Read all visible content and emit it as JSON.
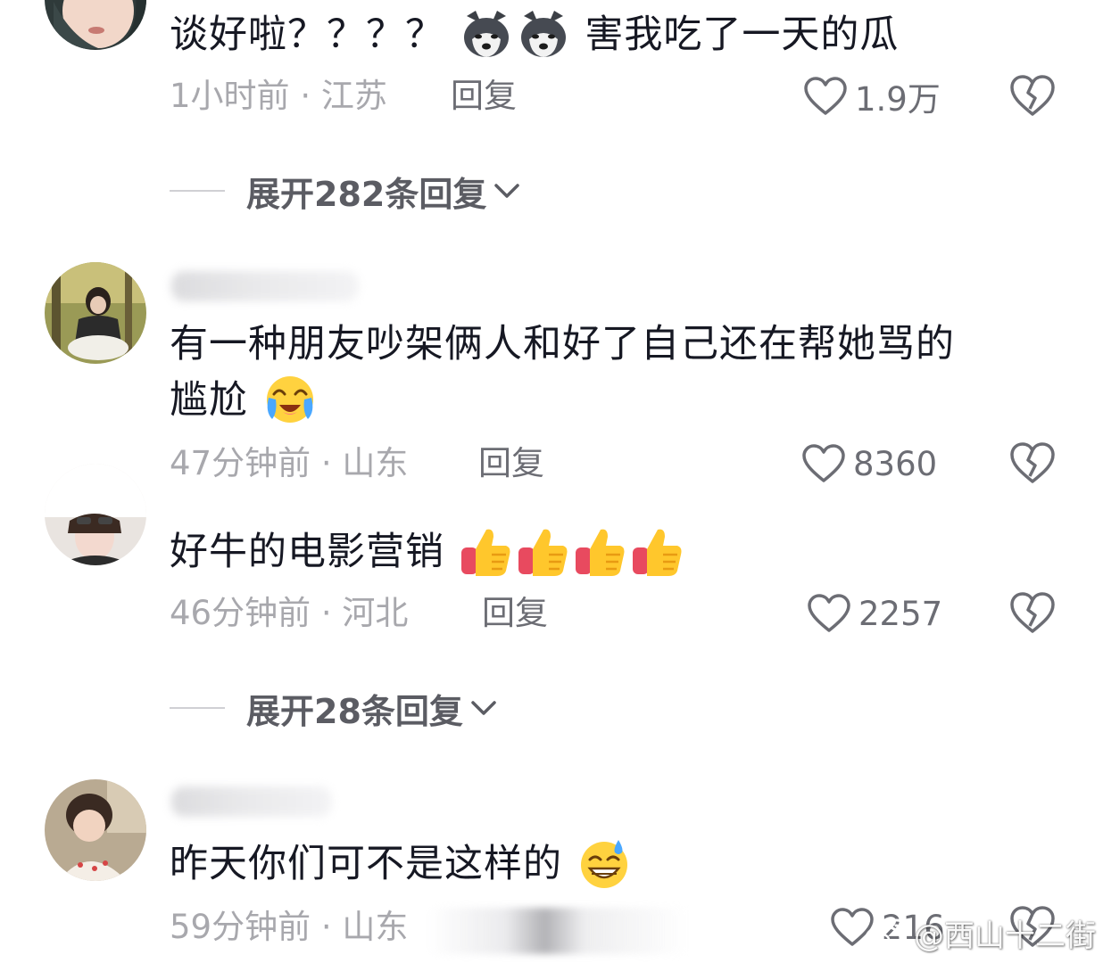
{
  "comments": [
    {
      "text_parts": [
        "谈好啦？？？？",
        "害我吃了一天的瓜"
      ],
      "emojis": [
        "husky-dog-emoji",
        "husky-dog-emoji"
      ],
      "time": "1小时前",
      "separator": "·",
      "location": "江苏",
      "reply_label": "回复",
      "likes": "1.9万"
    },
    {
      "username": "",
      "text_line1": "有一种朋友吵架俩人和好了自己还在帮她骂的",
      "text_line2": "尴尬",
      "emojis": [
        "crying-laughing-emoji"
      ],
      "time": "47分钟前",
      "separator": "·",
      "location": "山东",
      "reply_label": "回复",
      "likes": "8360"
    },
    {
      "text": "好牛的电影营销",
      "emojis": [
        "thumbs-up-emoji",
        "thumbs-up-emoji",
        "thumbs-up-emoji",
        "thumbs-up-emoji"
      ],
      "time": "46分钟前",
      "separator": "·",
      "location": "河北",
      "reply_label": "回复",
      "likes": "2257"
    },
    {
      "username": "",
      "text": "昨天你们可不是这样的",
      "emojis": [
        "sweat-smile-emoji"
      ],
      "time": "59分钟前",
      "separator": "·",
      "location": "山东",
      "likes": "216"
    }
  ],
  "expand_replies": [
    {
      "label": "展开282条回复"
    },
    {
      "label": "展开28条回复"
    }
  ],
  "watermark": {
    "text": "@西山十二街"
  },
  "colors": {
    "text_primary": "#161823",
    "text_secondary": "#a8a8ad",
    "action_gray": "#6c6d74",
    "divider": "#d0d0d4",
    "watermark": "#ffffff"
  }
}
